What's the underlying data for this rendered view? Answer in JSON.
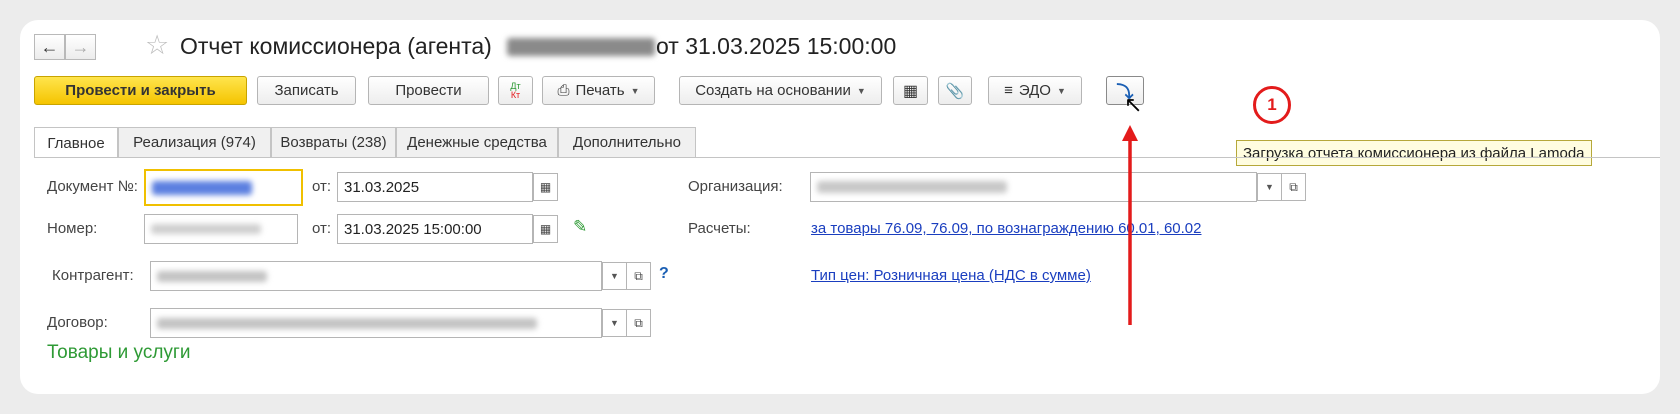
{
  "header": {
    "back_icon": "arrow-left-icon",
    "forward_icon": "arrow-right-icon",
    "favorite_icon": "star-icon",
    "title_prefix": "Отчет комиссионера (агента)",
    "title_suffix": "от 31.03.2025 15:00:00"
  },
  "toolbar": {
    "post_close_label": "Провести и закрыть",
    "save_label": "Записать",
    "post_label": "Провести",
    "dt_label": "Дт",
    "kt_label": "Кт",
    "print_label": "Печать",
    "create_based_label": "Создать на основании",
    "edo_label": "ЭДО",
    "load_tooltip": "Загрузка отчета комиссионера из файла Lamoda"
  },
  "tabs": [
    {
      "label": "Главное"
    },
    {
      "label": "Реализация (974)"
    },
    {
      "label": "Возвраты (238)"
    },
    {
      "label": "Денежные средства"
    },
    {
      "label": "Дополнительно"
    }
  ],
  "form": {
    "doc_no_label": "Документ №:",
    "number_label": "Номер:",
    "from_label": "от:",
    "date_value": "31.03.2025",
    "datetime_value": "31.03.2025 15:00:00",
    "org_label": "Организация:",
    "calc_label": "Расчеты:",
    "calc_link": "за товары 76.09, 76.09, по вознаграждению 60.01, 60.02",
    "contractor_label": "Контрагент:",
    "contract_label": "Договор:",
    "price_link": "Тип цен: Розничная цена (НДС в сумме)",
    "help_mark": "?"
  },
  "section": {
    "goods_title": "Товары и услуги"
  },
  "annotation": {
    "marker_number": "1"
  },
  "colors": {
    "accent_yellow": "#f5c400",
    "link_blue": "#1a3ebf",
    "annotation_red": "#e31b1b",
    "section_green": "#2e9a35"
  }
}
